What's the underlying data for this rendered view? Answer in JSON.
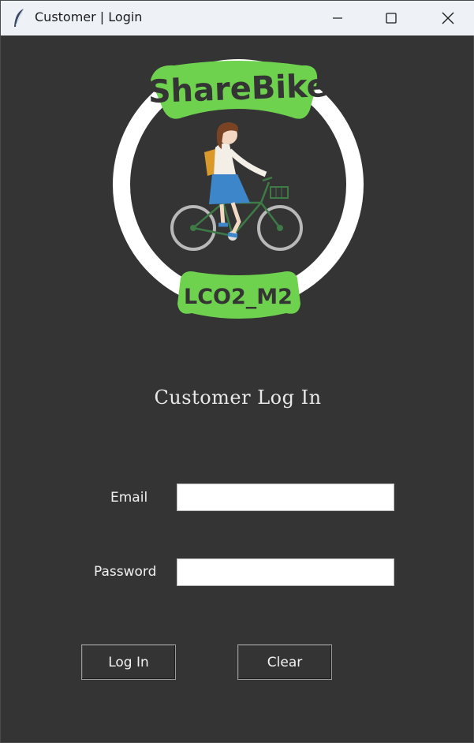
{
  "window": {
    "title": "Customer | Login",
    "controls": [
      "minimize",
      "maximize",
      "close"
    ]
  },
  "logo": {
    "top_text": "ShareBike",
    "bottom_text": "LCO2_M2",
    "image": "girl-on-bicycle",
    "accent_color": "#6fd24f",
    "ring_color": "#ffffff"
  },
  "form": {
    "heading": "Customer Log In",
    "email_label": "Email",
    "email_value": "",
    "password_label": "Password",
    "password_value": "",
    "login_button": "Log In",
    "clear_button": "Clear"
  },
  "colors": {
    "background": "#343434",
    "titlebar": "#eef2f7"
  }
}
